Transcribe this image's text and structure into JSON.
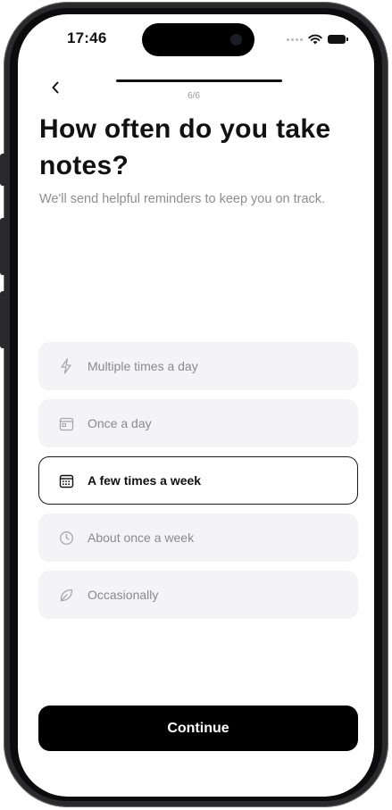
{
  "status_bar": {
    "time": "17:46"
  },
  "header": {
    "step_counter": "6/6",
    "progress": 1.0
  },
  "title": "How often do you take notes?",
  "subtitle": "We'll send helpful reminders to keep you on track.",
  "options": [
    {
      "label": "Multiple times a day",
      "icon": "lightning-icon",
      "selected": false
    },
    {
      "label": "Once a day",
      "icon": "calendar-day-icon",
      "selected": false
    },
    {
      "label": "A few times a week",
      "icon": "calendar-week-icon",
      "selected": true
    },
    {
      "label": "About once a week",
      "icon": "clock-icon",
      "selected": false
    },
    {
      "label": "Occasionally",
      "icon": "leaf-icon",
      "selected": false
    }
  ],
  "continue_label": "Continue",
  "colors": {
    "primary": "#000000",
    "option_bg": "#f4f4f6",
    "muted_text": "#8a8a8a"
  }
}
